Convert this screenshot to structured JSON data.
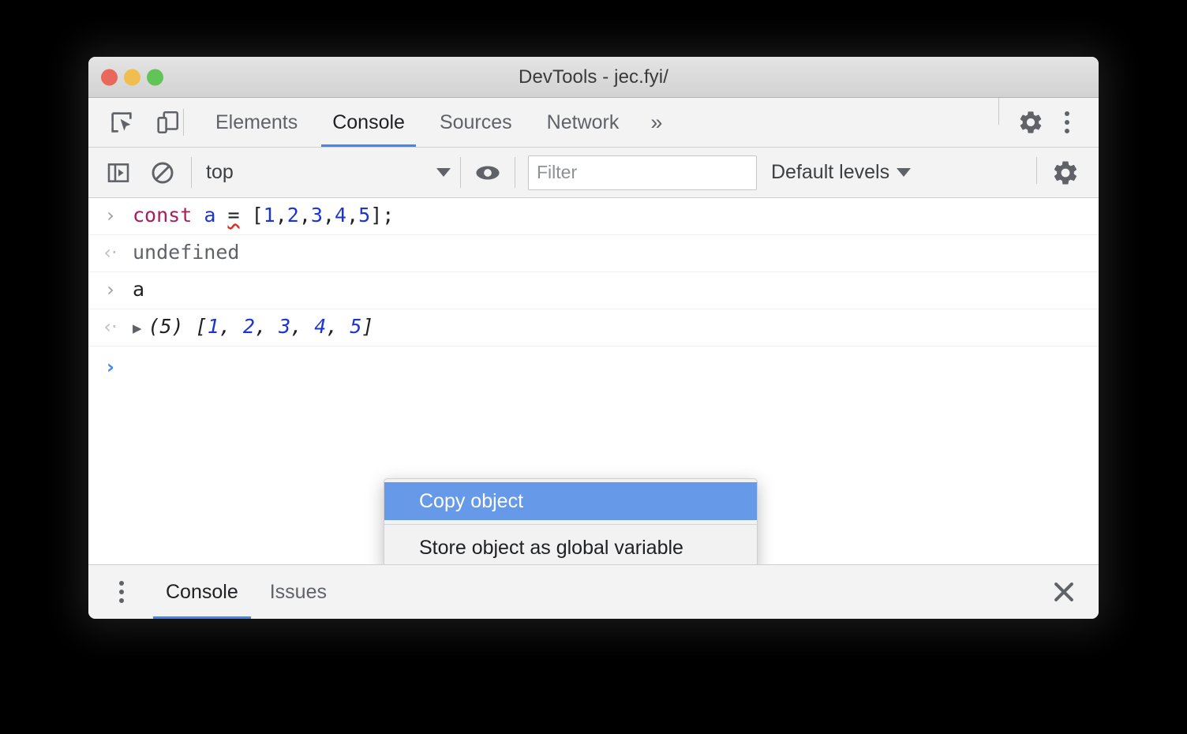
{
  "window": {
    "title": "DevTools - jec.fyi/",
    "traffic_lights": [
      {
        "name": "close",
        "color": "#e8695c"
      },
      {
        "name": "minimize",
        "color": "#f0be4e"
      },
      {
        "name": "zoom",
        "color": "#61c358"
      }
    ]
  },
  "tabbar": {
    "icons": [
      {
        "name": "inspect-element-icon"
      },
      {
        "name": "device-toolbar-icon"
      }
    ],
    "tabs": [
      {
        "label": "Elements",
        "active": false
      },
      {
        "label": "Console",
        "active": true
      },
      {
        "label": "Sources",
        "active": false
      },
      {
        "label": "Network",
        "active": false
      }
    ],
    "more_label": "»",
    "settings_label": "settings-icon",
    "kebab_label": "more-options-icon",
    "active_underline_color": "#4285f4"
  },
  "console_toolbar": {
    "sidebar_toggle": "console-sidebar-icon",
    "clear_console": "clear-console-icon",
    "context_value": "top",
    "context_caret": "▼",
    "eye_icon": "live-expression-eye-icon",
    "filter": {
      "value": "",
      "placeholder": "Filter"
    },
    "levels_label": "Default levels",
    "levels_caret": "▼",
    "settings_icon": "console-settings-icon"
  },
  "console_messages": [
    {
      "gutter": "›",
      "gutter_type": "input",
      "type": "input",
      "tokens": [
        {
          "text": "const",
          "cls": "kw-const"
        },
        {
          "text": " ",
          "cls": "plain"
        },
        {
          "text": "a",
          "cls": "ident"
        },
        {
          "text": " ",
          "cls": "plain"
        },
        {
          "text": "=",
          "cls": "op-bad"
        },
        {
          "text": " ",
          "cls": "plain"
        },
        {
          "text": "[",
          "cls": "plain"
        },
        {
          "text": "1",
          "cls": "num"
        },
        {
          "text": ",",
          "cls": "plain"
        },
        {
          "text": "2",
          "cls": "num"
        },
        {
          "text": ",",
          "cls": "plain"
        },
        {
          "text": "3",
          "cls": "num"
        },
        {
          "text": ",",
          "cls": "plain"
        },
        {
          "text": "4",
          "cls": "num"
        },
        {
          "text": ",",
          "cls": "plain"
        },
        {
          "text": "5",
          "cls": "num"
        },
        {
          "text": "];",
          "cls": "plain"
        }
      ]
    },
    {
      "gutter": "‹·",
      "gutter_type": "output",
      "type": "output",
      "tokens": [
        {
          "text": "undefined",
          "cls": "undefined-val"
        }
      ]
    },
    {
      "gutter": "›",
      "gutter_type": "input",
      "type": "input",
      "tokens": [
        {
          "text": "a",
          "cls": "plain"
        }
      ]
    },
    {
      "gutter": "‹·",
      "gutter_type": "output",
      "type": "object",
      "disclosure": "▶",
      "tokens": [
        {
          "text": "(5)",
          "cls": "plain"
        },
        {
          "text": " ",
          "cls": "plain"
        },
        {
          "text": "[",
          "cls": "plain"
        },
        {
          "text": "1",
          "cls": "num"
        },
        {
          "text": ", ",
          "cls": "plain"
        },
        {
          "text": "2",
          "cls": "num"
        },
        {
          "text": ", ",
          "cls": "plain"
        },
        {
          "text": "3",
          "cls": "num"
        },
        {
          "text": ", ",
          "cls": "plain"
        },
        {
          "text": "4",
          "cls": "num"
        },
        {
          "text": ", ",
          "cls": "plain"
        },
        {
          "text": "5",
          "cls": "num"
        },
        {
          "text": "]",
          "cls": "plain"
        }
      ]
    }
  ],
  "prompt": {
    "chevron": "›",
    "value": ""
  },
  "context_menu": {
    "items": [
      {
        "label": "Copy object",
        "selected": true
      },
      {
        "label": "Store object as global variable",
        "selected": false
      }
    ],
    "highlight_color": "#6699e8"
  },
  "drawer": {
    "kebab": "drawer-more-options-icon",
    "tabs": [
      {
        "label": "Console",
        "active": true
      },
      {
        "label": "Issues",
        "active": false
      }
    ],
    "close_label": "✕"
  }
}
